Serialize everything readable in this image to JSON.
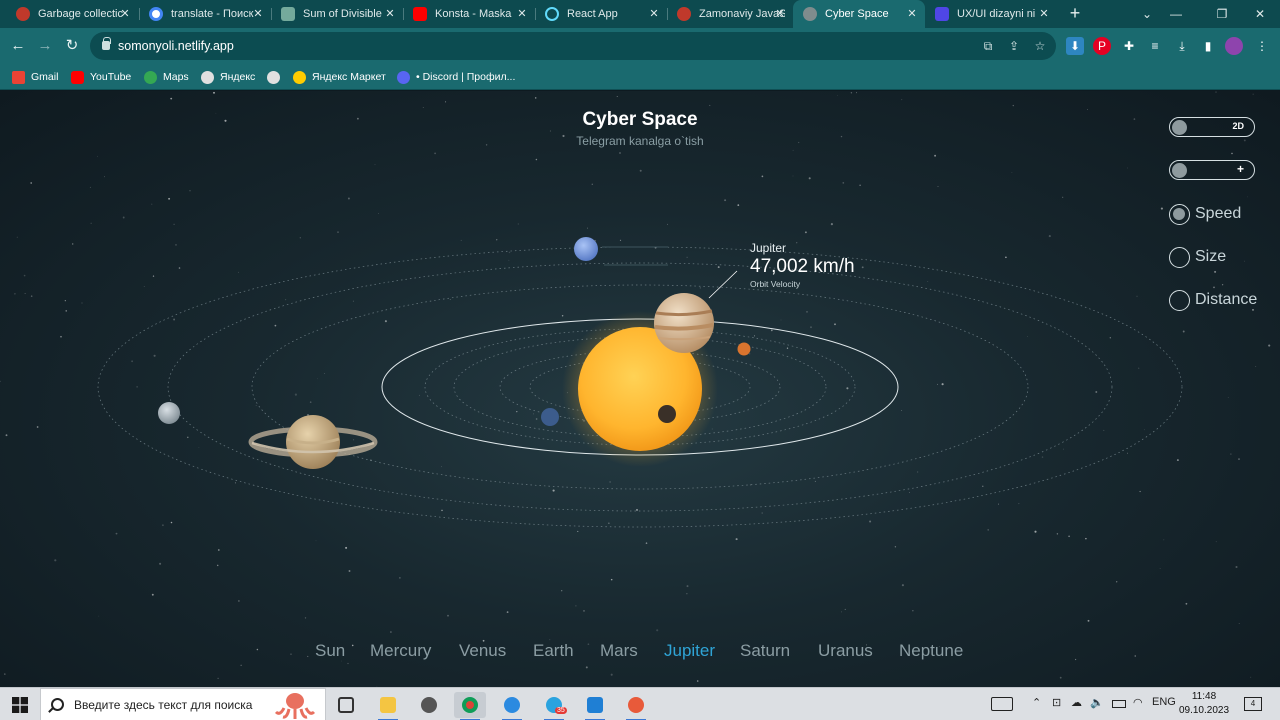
{
  "browser": {
    "tabs": [
      {
        "label": "Garbage collectic",
        "icon": "garbage-favicon",
        "color": "#c0392b"
      },
      {
        "label": "translate - Поиск",
        "icon": "google-favicon",
        "color": "#ffffff"
      },
      {
        "label": "Sum of Divisible",
        "icon": "chatgpt-favicon",
        "color": "#74aa9c"
      },
      {
        "label": "Konsta - Maska",
        "icon": "youtube-favicon",
        "color": "#ff0000"
      },
      {
        "label": "React App",
        "icon": "react-favicon",
        "color": "#61dafb"
      },
      {
        "label": "Zamonaviy JavaS",
        "icon": "code-favicon",
        "color": "#c0392b"
      },
      {
        "label": "Cyber Space",
        "icon": "globe-favicon",
        "color": "#7f8c8d",
        "active": true
      },
      {
        "label": "UX/UI dizayni ni",
        "icon": "s-favicon",
        "color": "#4f46e5"
      }
    ],
    "new_tab_symbol": "+",
    "url": "somonyoli.netlify.app"
  },
  "bookmarks": [
    {
      "label": "Gmail",
      "icon": "gmail-icon",
      "color": "#ea4335"
    },
    {
      "label": "YouTube",
      "icon": "youtube-icon",
      "color": "#ff0000"
    },
    {
      "label": "Maps",
      "icon": "maps-icon",
      "color": "#34a853"
    },
    {
      "label": "Яндекс",
      "icon": "globe-icon",
      "color": "#e0e0e0"
    },
    {
      "label": "",
      "icon": "globe-icon",
      "color": "#e0e0e0"
    },
    {
      "label": "Яндекс Маркет",
      "icon": "market-icon",
      "color": "#ffcc00"
    },
    {
      "label": "• Discord | Профил...",
      "icon": "discord-icon",
      "color": "#5865f2"
    }
  ],
  "page": {
    "title": "Cyber Space",
    "subtitle": "Telegram kanalga o`tish",
    "toggles": [
      {
        "name": "view-toggle",
        "label": "2D"
      },
      {
        "name": "zoom-toggle",
        "label": "+"
      }
    ],
    "options": [
      {
        "label": "Speed",
        "selected": true
      },
      {
        "label": "Size",
        "selected": false
      },
      {
        "label": "Distance",
        "selected": false
      }
    ],
    "info": {
      "planet": "Jupiter",
      "value": "47,002 km/h",
      "label": "Orbit Velocity"
    },
    "planets": [
      {
        "label": "Sun",
        "active": false
      },
      {
        "label": "Mercury",
        "active": false
      },
      {
        "label": "Venus",
        "active": false
      },
      {
        "label": "Earth",
        "active": false
      },
      {
        "label": "Mars",
        "active": false
      },
      {
        "label": "Jupiter",
        "active": true
      },
      {
        "label": "Saturn",
        "active": false
      },
      {
        "label": "Uranus",
        "active": false
      },
      {
        "label": "Neptune",
        "active": false
      }
    ],
    "colors": {
      "accent": "#2fa4d6",
      "sun": "#ffb52e",
      "background": "#18282f"
    }
  },
  "taskbar": {
    "search_placeholder": "Введите здесь текст для поиска",
    "language": "ENG",
    "time": "11:48",
    "date": "09.10.2023",
    "notification_count": "4",
    "telegram_badge": "35"
  }
}
